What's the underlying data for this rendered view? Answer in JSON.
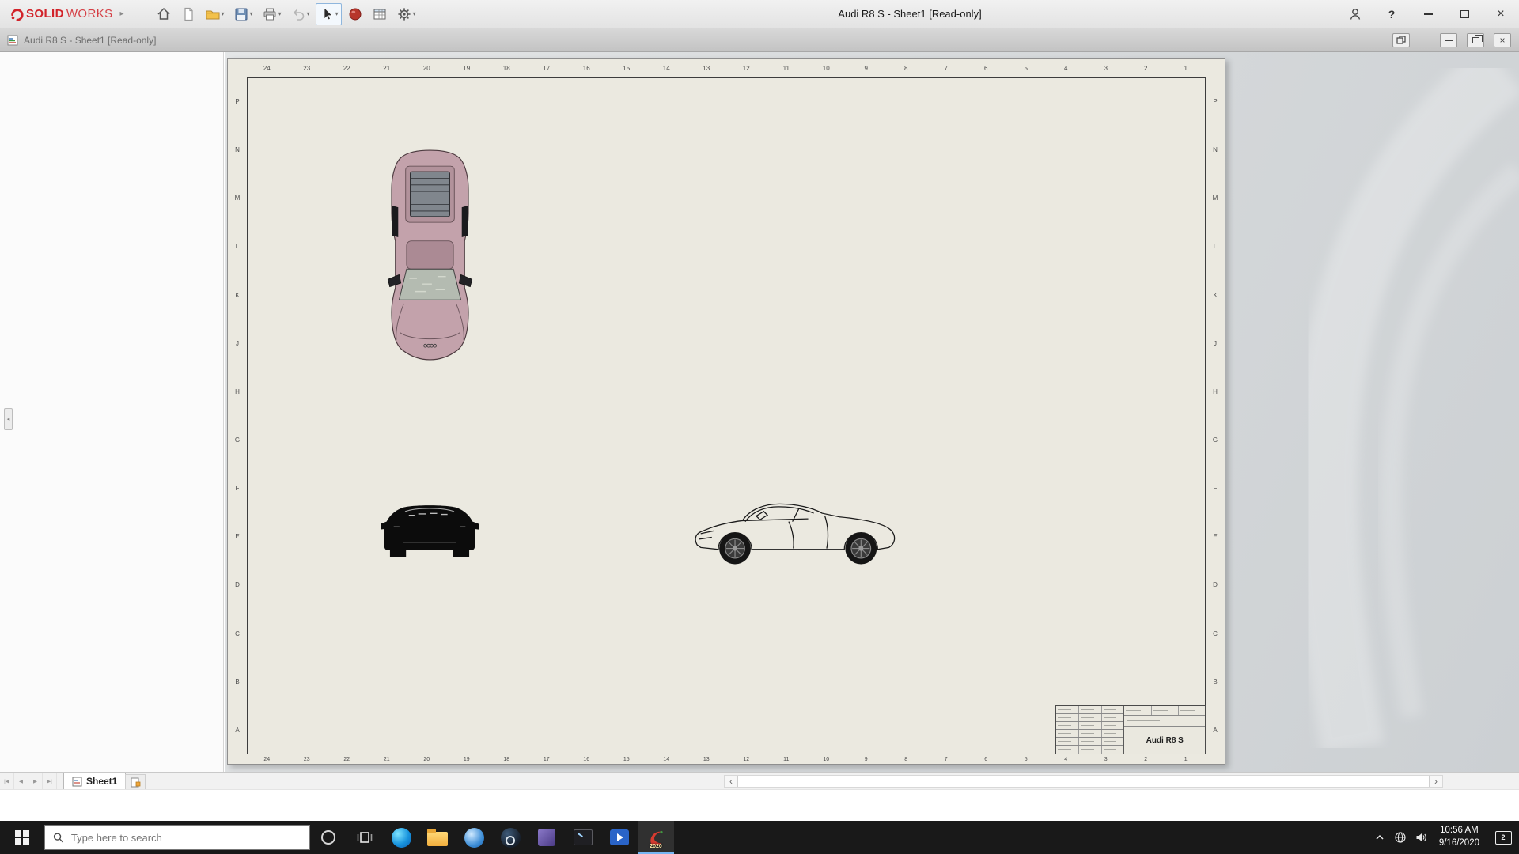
{
  "app": {
    "brand_solid": "SOLID",
    "brand_works": "WORKS",
    "window_title": "Audi R8 S - Sheet1 [Read-only]"
  },
  "glyphs": {
    "brand_expand": "▸",
    "dropdown_caret": "▾",
    "help": "?",
    "close": "×",
    "nav_first": "|◀",
    "nav_prev": "◀",
    "nav_next": "▶",
    "nav_last": "▶|",
    "scroll_left": "‹",
    "scroll_right": "›",
    "panel_collapse": "◂"
  },
  "doc_window": {
    "title": "Audi R8 S - Sheet1 [Read-only]"
  },
  "sheet": {
    "zone_columns": [
      "24",
      "23",
      "22",
      "21",
      "20",
      "19",
      "18",
      "17",
      "16",
      "15",
      "14",
      "13",
      "12",
      "11",
      "10",
      "9",
      "8",
      "7",
      "6",
      "5",
      "4",
      "3",
      "2",
      "1"
    ],
    "zone_rows": [
      "P",
      "N",
      "M",
      "L",
      "K",
      "J",
      "H",
      "G",
      "F",
      "E",
      "D",
      "C",
      "B",
      "A"
    ],
    "title_block_part": "Audi R8 S"
  },
  "tabs": {
    "sheet1": "Sheet1"
  },
  "taskbar": {
    "search_placeholder": "Type here to search",
    "solidworks_version": "2020",
    "time": "10:56 AM",
    "date": "9/16/2020",
    "notification_count": "2"
  },
  "colors": {
    "brand_red": "#d2232a",
    "sheet_paper": "#ebe9e0",
    "taskbar_bg": "#191919",
    "car_body_pink": "#c3a2ab"
  }
}
